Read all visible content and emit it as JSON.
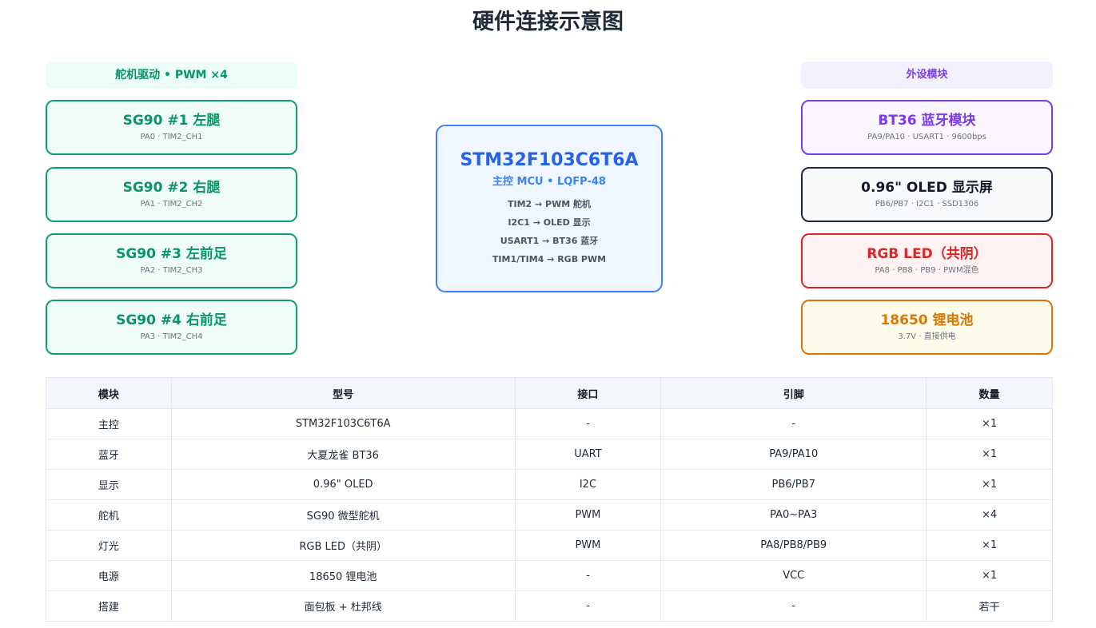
{
  "page": {
    "title": "硬件连接示意图"
  },
  "servo_group": {
    "title": "舵机驱动 • PWM ×4",
    "nodes": [
      {
        "title": "SG90 #1 左腿",
        "sub": "PA0 · TIM2_CH1"
      },
      {
        "title": "SG90 #2 右腿",
        "sub": "PA1 · TIM2_CH2"
      },
      {
        "title": "SG90 #3 左前足",
        "sub": "PA2 · TIM2_CH3"
      },
      {
        "title": "SG90 #4 右前足",
        "sub": "PA3 · TIM2_CH4"
      }
    ]
  },
  "mcu": {
    "title": "STM32F103C6T6A",
    "subtitle": "主控 MCU • LQFP-48",
    "lines": [
      "TIM2 → PWM 舵机",
      "I2C1 → OLED 显示",
      "USART1 → BT36 蓝牙",
      "TIM1/TIM4 → RGB PWM"
    ]
  },
  "peripheral_group": {
    "title": "外设模块",
    "nodes": [
      {
        "title": "BT36 蓝牙模块",
        "sub": "PA9/PA10 · USART1 · 9600bps"
      },
      {
        "title": "0.96\" OLED 显示屏",
        "sub": "PB6/PB7 · I2C1 · SSD1306"
      },
      {
        "title": "RGB LED（共阴）",
        "sub": "PA8 · PB8 · PB9 · PWM混色"
      },
      {
        "title": "18650 锂电池",
        "sub": "3.7V · 直接供电"
      }
    ]
  },
  "table": {
    "headers": [
      "模块",
      "型号",
      "接口",
      "引脚",
      "数量"
    ],
    "rows": [
      [
        "主控",
        "STM32F103C6T6A",
        "-",
        "-",
        "×1"
      ],
      [
        "蓝牙",
        "大夏龙雀 BT36",
        "UART",
        "PA9/PA10",
        "×1"
      ],
      [
        "显示",
        "0.96\" OLED",
        "I2C",
        "PB6/PB7",
        "×1"
      ],
      [
        "舵机",
        "SG90 微型舵机",
        "PWM",
        "PA0~PA3",
        "×4"
      ],
      [
        "灯光",
        "RGB LED（共阴）",
        "PWM",
        "PA8/PB8/PB9",
        "×1"
      ],
      [
        "电源",
        "18650 锂电池",
        "-",
        "VCC",
        "×1"
      ],
      [
        "搭建",
        "面包板 + 杜邦线",
        "-",
        "-",
        "若干"
      ]
    ]
  },
  "colors": {
    "servo": "#059669",
    "mcu": "#2563eb",
    "bluetooth": "#7c3aed",
    "oled": "#1e293b",
    "rgb": "#dc2626",
    "battery": "#d97706"
  }
}
